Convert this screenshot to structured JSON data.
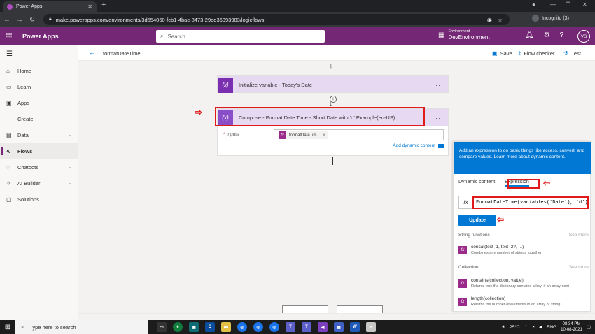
{
  "browser": {
    "tab_title": "Power Apps",
    "url": "make.powerapps.com/environments/3d554060-fcb1-4bac-8473-29dd36093983/logicflows",
    "profile": "Incognito (3)"
  },
  "header": {
    "app_name": "Power Apps",
    "search_placeholder": "Search",
    "env_label": "Environment",
    "env_name": "DevEnvironment",
    "avatar": "VS"
  },
  "nav": {
    "items": [
      {
        "label": "Home",
        "icon": "home-icon"
      },
      {
        "label": "Learn",
        "icon": "book-icon"
      },
      {
        "label": "Apps",
        "icon": "apps-icon"
      },
      {
        "label": "Create",
        "icon": "plus-icon"
      },
      {
        "label": "Data",
        "icon": "table-icon"
      },
      {
        "label": "Flows",
        "icon": "flow-icon"
      },
      {
        "label": "Chatbots",
        "icon": "chatbot-icon"
      },
      {
        "label": "AI Builder",
        "icon": "ai-icon"
      },
      {
        "label": "Solutions",
        "icon": "solutions-icon"
      }
    ]
  },
  "commandbar": {
    "flow_name": "formatDateTime",
    "save": "Save",
    "checker": "Flow checker",
    "test": "Test"
  },
  "canvas": {
    "step1_title": "Initialize variable - Today's Date",
    "step1_badge": "{x}",
    "step2_title": "Compose - Format Date Time - Short Date with 'd' Example(en-US)",
    "step2_badge": "{x}",
    "inputs_label": "Inputs",
    "token_text": "formatDateTim...",
    "token_fx": "fx",
    "add_dynamic": "Add dynamic content"
  },
  "panel": {
    "info_text": "Add an expression to do basic things like access, convert, and compare values.",
    "info_link": "Learn more about dynamic content.",
    "tab_dynamic": "Dynamic content",
    "tab_expression": "Expression",
    "fx_label": "fx",
    "expression": "FormatDateTime(variables('Date'), 'd')",
    "update": "Update",
    "section_string": "String functions",
    "section_collection": "Collection",
    "see_more": "See more",
    "functions": [
      {
        "name": "concat(text_1, text_2?, ...)",
        "desc": "Combines any number of strings together"
      },
      {
        "name": "contains(collection, value)",
        "desc": "Returns true if a dictionary contains a key, if an array cont"
      },
      {
        "name": "length(collection)",
        "desc": "Returns the number of elements in an array or string"
      }
    ]
  },
  "taskbar": {
    "search_placeholder": "Type here to search",
    "weather": "25°C",
    "lang": "ENG",
    "time": "08:34 PM",
    "date": "10-08-2021"
  },
  "colors": {
    "brand": "#742774",
    "accent": "#0078d4",
    "highlight": "#e01a1a"
  }
}
